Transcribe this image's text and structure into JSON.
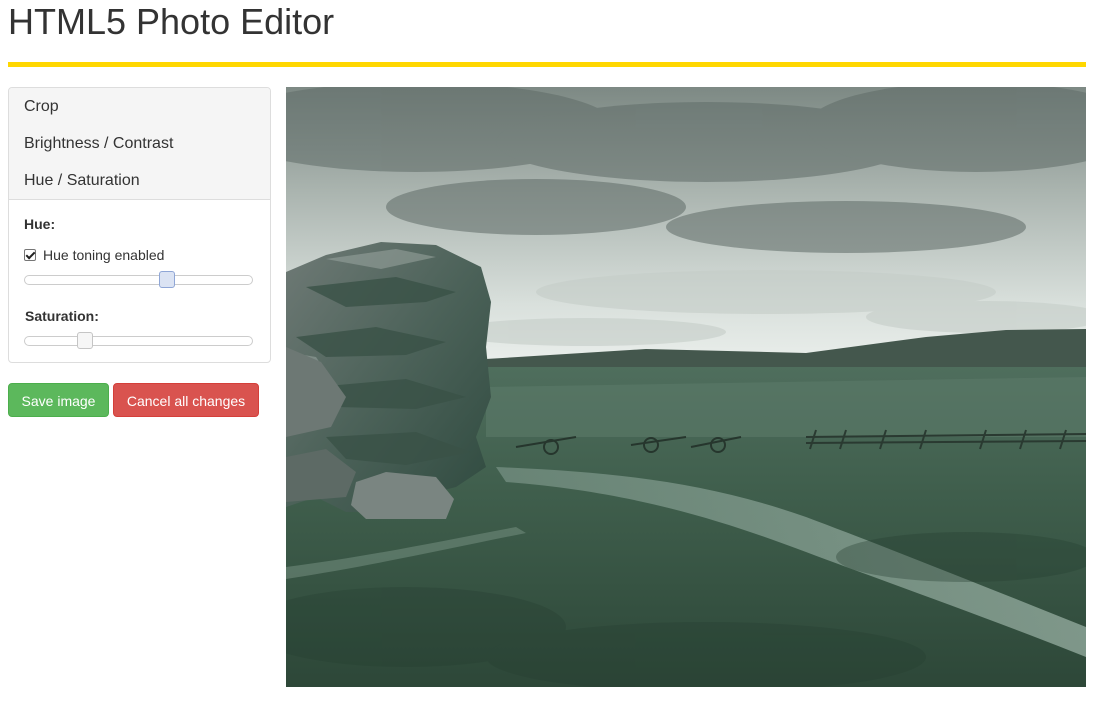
{
  "header": {
    "title": "HTML5 Photo Editor"
  },
  "tools": {
    "items": [
      {
        "label": "Crop"
      },
      {
        "label": "Brightness / Contrast"
      },
      {
        "label": "Hue / Saturation"
      }
    ]
  },
  "hue_saturation": {
    "hue_label": "Hue:",
    "hue_toning_label": "Hue toning enabled",
    "hue_toning_enabled": true,
    "hue_value_fraction": 0.62,
    "saturation_label": "Saturation:",
    "saturation_value_fraction": 0.26
  },
  "actions": {
    "save_label": "Save image",
    "cancel_label": "Cancel all changes"
  },
  "colors": {
    "accent_rule": "#ffd700",
    "save_button": "#5cb85c",
    "cancel_button": "#d9534f"
  }
}
